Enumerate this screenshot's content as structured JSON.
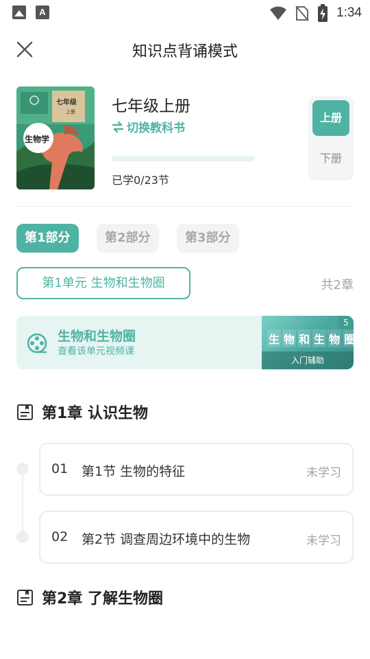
{
  "status_bar": {
    "time": "1:34"
  },
  "header": {
    "title": "知识点背诵模式"
  },
  "book": {
    "cover_series": "七年级",
    "cover_volume": "上册",
    "cover_subject": "生物学",
    "grade_title": "七年级上册",
    "switch_label": "切换教科书",
    "progress": 0,
    "learned_text": "已学0/23节",
    "volume_up": "上册",
    "volume_down": "下册"
  },
  "parts": [
    {
      "label": "第1部分",
      "active": true
    },
    {
      "label": "第2部分",
      "active": false
    },
    {
      "label": "第3部分",
      "active": false
    }
  ],
  "unit": {
    "label": "第1单元 生物和生物圈",
    "total": "共2章"
  },
  "video_banner": {
    "title": "生物和生物圈",
    "subtitle": "查看该单元视频课",
    "thumb_chars": [
      "生",
      "物",
      "和",
      "生",
      "物",
      "圈"
    ],
    "thumb_footer": "入门辅助",
    "badge": "5"
  },
  "chapters": [
    {
      "title": "第1章 认识生物",
      "sections": [
        {
          "num": "01",
          "title": "第1节 生物的特征",
          "status": "未学习"
        },
        {
          "num": "02",
          "title": "第2节 调查周边环境中的生物",
          "status": "未学习"
        }
      ]
    },
    {
      "title": "第2章 了解生物圈",
      "sections": []
    }
  ],
  "colors": {
    "accent": "#4fb3a3",
    "muted": "#a3a3a3"
  }
}
